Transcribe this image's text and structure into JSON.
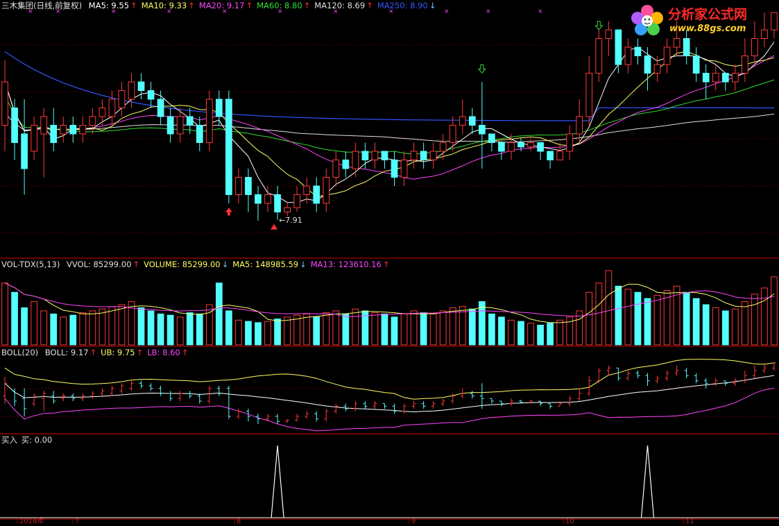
{
  "header": {
    "stock_name": "三木集团(日线,前复权)",
    "items": [
      {
        "text": "MA5: 9.55",
        "color": "#ffffff",
        "arrow": "↑",
        "arrow_color": "#ff3030"
      },
      {
        "text": "MA10: 9.33",
        "color": "#ffff66",
        "arrow": "↑",
        "arrow_color": "#ff3030"
      },
      {
        "text": "MA20: 9.17",
        "color": "#ff44ff",
        "arrow": "↑",
        "arrow_color": "#ff3030"
      },
      {
        "text": "MA60: 8.80",
        "color": "#33dd33",
        "arrow": "↑",
        "arrow_color": "#ff3030"
      },
      {
        "text": "MA120: 8.69",
        "color": "#e0e0e0",
        "arrow": "↑",
        "arrow_color": "#ff3030"
      },
      {
        "text": "MA250: 8.90",
        "color": "#3355ff",
        "arrow": "↓",
        "arrow_color": "#66ccff"
      }
    ]
  },
  "volume_header": {
    "label": "VOL-TDX(5,13)",
    "items": [
      {
        "text": "VVOL: 85299.00",
        "color": "#e0e0e0",
        "arrow": "↑",
        "arrow_color": "#ff3030"
      },
      {
        "text": "VOLUME: 85299.00",
        "color": "#ffff66",
        "arrow": "↓",
        "arrow_color": "#66ccff"
      },
      {
        "text": "MA5: 148985.59",
        "color": "#ffff66",
        "arrow": "↓",
        "arrow_color": "#66ccff"
      },
      {
        "text": "MA13: 123610.16",
        "color": "#ff44ff",
        "arrow": "↑",
        "arrow_color": "#ff3030"
      }
    ]
  },
  "boll_header": {
    "label": "BOLL(20)",
    "items": [
      {
        "text": "BOLL: 9.17",
        "color": "#e0e0e0",
        "arrow": "↑",
        "arrow_color": "#ff3030"
      },
      {
        "text": "UB: 9.75",
        "color": "#ffff66",
        "arrow": "↑",
        "arrow_color": "#ff3030"
      },
      {
        "text": "LB: 8.60",
        "color": "#ff44ff",
        "arrow": "↑",
        "arrow_color": "#ff3030"
      }
    ]
  },
  "signal_header": {
    "label": "买入",
    "text": "买: 0.00"
  },
  "logo": {
    "name": "分析家公式网",
    "url": "www.88gs.com"
  },
  "colors": {
    "up": "#ff3b3b",
    "down": "#54ffff",
    "ma5": "#ffffff",
    "ma10": "#ffff66",
    "ma20": "#ff44ff",
    "ma60": "#33dd33",
    "ma120": "#e0e0e0",
    "ma250": "#3355ff",
    "grid": "#8b0000",
    "signal": "#ffffff"
  },
  "chart_data": {
    "type": "candlestick",
    "price_ylim": [
      7.5,
      10.3
    ],
    "low_annotation": "7.91",
    "candles": [
      [
        9.0,
        9.5,
        8.7,
        9.75
      ],
      [
        9.2,
        8.8,
        8.6,
        9.3
      ],
      [
        8.9,
        8.5,
        8.2,
        9.3
      ],
      [
        8.7,
        9.0,
        8.6,
        9.1
      ],
      [
        8.9,
        9.1,
        8.4,
        9.2
      ],
      [
        9.0,
        8.8,
        8.7,
        9.2
      ],
      [
        8.9,
        9.0,
        8.8,
        9.1
      ],
      [
        9.0,
        8.9,
        8.8,
        9.1
      ],
      [
        8.9,
        9.0,
        8.8,
        9.1
      ],
      [
        9.0,
        9.1,
        8.9,
        9.2
      ],
      [
        9.1,
        9.2,
        9.0,
        9.3
      ],
      [
        9.1,
        9.3,
        9.0,
        9.4
      ],
      [
        9.2,
        9.4,
        9.1,
        9.5
      ],
      [
        9.3,
        9.5,
        9.2,
        9.6
      ],
      [
        9.5,
        9.4,
        9.3,
        9.6
      ],
      [
        9.4,
        9.3,
        9.2,
        9.5
      ],
      [
        9.3,
        9.1,
        9.0,
        9.4
      ],
      [
        9.1,
        8.9,
        8.8,
        9.2
      ],
      [
        8.9,
        9.1,
        8.8,
        9.2
      ],
      [
        9.1,
        9.0,
        8.9,
        9.2
      ],
      [
        9.0,
        8.8,
        8.7,
        9.1
      ],
      [
        8.8,
        9.3,
        8.7,
        9.4
      ],
      [
        9.3,
        9.1,
        9.0,
        9.4
      ],
      [
        9.3,
        8.2,
        8.1,
        9.4
      ],
      [
        8.2,
        8.4,
        8.1,
        8.5
      ],
      [
        8.4,
        8.2,
        8.0,
        8.5
      ],
      [
        8.2,
        8.1,
        7.9,
        8.3
      ],
      [
        8.1,
        8.2,
        8.0,
        8.3
      ],
      [
        8.2,
        8.0,
        7.91,
        8.3
      ],
      [
        8.0,
        8.05,
        7.95,
        8.1
      ],
      [
        8.05,
        8.2,
        8.0,
        8.3
      ],
      [
        8.2,
        8.3,
        8.1,
        8.4
      ],
      [
        8.3,
        8.1,
        8.0,
        8.4
      ],
      [
        8.1,
        8.4,
        8.0,
        8.5
      ],
      [
        8.4,
        8.6,
        8.3,
        8.7
      ],
      [
        8.6,
        8.5,
        8.4,
        8.7
      ],
      [
        8.5,
        8.7,
        8.4,
        8.8
      ],
      [
        8.7,
        8.6,
        8.5,
        8.8
      ],
      [
        8.6,
        8.7,
        8.5,
        8.8
      ],
      [
        8.7,
        8.6,
        8.5,
        8.7
      ],
      [
        8.6,
        8.4,
        8.3,
        8.7
      ],
      [
        8.4,
        8.6,
        8.3,
        8.7
      ],
      [
        8.6,
        8.7,
        8.5,
        8.8
      ],
      [
        8.7,
        8.6,
        8.5,
        8.8
      ],
      [
        8.6,
        8.7,
        8.5,
        8.8
      ],
      [
        8.7,
        8.8,
        8.6,
        8.9
      ],
      [
        8.8,
        9.0,
        8.7,
        9.1
      ],
      [
        9.0,
        9.1,
        8.9,
        9.3
      ],
      [
        9.1,
        9.0,
        8.9,
        9.2
      ],
      [
        9.0,
        8.9,
        8.5,
        9.5
      ],
      [
        8.9,
        8.8,
        8.7,
        8.9
      ],
      [
        8.8,
        8.7,
        8.6,
        8.8
      ],
      [
        8.7,
        8.8,
        8.6,
        8.9
      ],
      [
        8.8,
        8.75,
        8.7,
        8.85
      ],
      [
        8.75,
        8.8,
        8.7,
        8.85
      ],
      [
        8.8,
        8.7,
        8.6,
        8.8
      ],
      [
        8.7,
        8.6,
        8.5,
        8.7
      ],
      [
        8.6,
        8.7,
        8.6,
        8.8
      ],
      [
        8.7,
        8.9,
        8.6,
        9.0
      ],
      [
        8.9,
        9.1,
        8.8,
        9.3
      ],
      [
        9.1,
        9.6,
        9.0,
        9.8
      ],
      [
        9.6,
        10.0,
        9.5,
        10.1
      ],
      [
        10.0,
        10.1,
        9.8,
        10.2
      ],
      [
        10.1,
        9.7,
        9.6,
        10.1
      ],
      [
        9.7,
        9.9,
        9.6,
        10.0
      ],
      [
        9.9,
        9.8,
        9.7,
        10.0
      ],
      [
        9.8,
        9.6,
        9.4,
        9.9
      ],
      [
        9.6,
        9.7,
        9.5,
        9.8
      ],
      [
        9.7,
        9.9,
        9.6,
        10.0
      ],
      [
        9.9,
        10.0,
        9.8,
        10.2
      ],
      [
        10.0,
        9.8,
        9.7,
        10.1
      ],
      [
        9.8,
        9.6,
        9.5,
        9.9
      ],
      [
        9.6,
        9.5,
        9.3,
        9.7
      ],
      [
        9.5,
        9.6,
        9.4,
        9.7
      ],
      [
        9.6,
        9.5,
        9.4,
        9.6
      ],
      [
        9.5,
        9.6,
        9.4,
        9.7
      ],
      [
        9.6,
        9.8,
        9.5,
        10.0
      ],
      [
        9.8,
        10.0,
        9.7,
        10.2
      ],
      [
        10.0,
        10.1,
        9.9,
        10.3
      ],
      [
        10.1,
        10.3,
        10.0,
        10.3
      ]
    ],
    "volumes": [
      100,
      85,
      60,
      70,
      55,
      50,
      45,
      48,
      52,
      55,
      58,
      62,
      65,
      70,
      60,
      55,
      50,
      48,
      45,
      52,
      50,
      65,
      100,
      55,
      40,
      38,
      36,
      38,
      42,
      45,
      48,
      50,
      45,
      52,
      55,
      50,
      58,
      55,
      52,
      50,
      45,
      50,
      55,
      52,
      50,
      55,
      60,
      62,
      58,
      70,
      50,
      45,
      40,
      38,
      35,
      32,
      35,
      40,
      45,
      55,
      85,
      100,
      120,
      95,
      90,
      85,
      75,
      80,
      88,
      95,
      85,
      75,
      65,
      60,
      55,
      58,
      70,
      82,
      92,
      110
    ],
    "signal": {
      "values": [
        0,
        1
      ],
      "spikes_at": [
        28,
        66
      ]
    },
    "x_ticks": [
      "2016年",
      "7",
      "8",
      "9",
      "10",
      "11"
    ]
  }
}
